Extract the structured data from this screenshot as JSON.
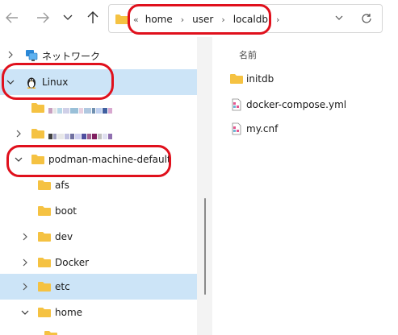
{
  "address": {
    "overflow_glyph": "«",
    "crumbs": [
      "home",
      "user",
      "localdb"
    ]
  },
  "tree": {
    "items": [
      {
        "key": "network",
        "label": "ネットワーク"
      },
      {
        "key": "linux",
        "label": "Linux"
      },
      {
        "key": "podman",
        "label": "podman-machine-default"
      },
      {
        "key": "afs",
        "label": "afs"
      },
      {
        "key": "boot",
        "label": "boot"
      },
      {
        "key": "dev",
        "label": "dev"
      },
      {
        "key": "docker",
        "label": "Docker"
      },
      {
        "key": "etc",
        "label": "etc"
      },
      {
        "key": "home",
        "label": "home"
      }
    ]
  },
  "content": {
    "column_name": "名前",
    "files": [
      {
        "name": "initdb",
        "icon": "folder-icon"
      },
      {
        "name": "docker-compose.yml",
        "icon": "yml-file-icon"
      },
      {
        "name": "my.cnf",
        "icon": "cnf-file-icon"
      }
    ]
  },
  "colors": {
    "accent_highlight": "#e0101c",
    "selection": "#cce4f7",
    "folder": "#f5c242"
  }
}
